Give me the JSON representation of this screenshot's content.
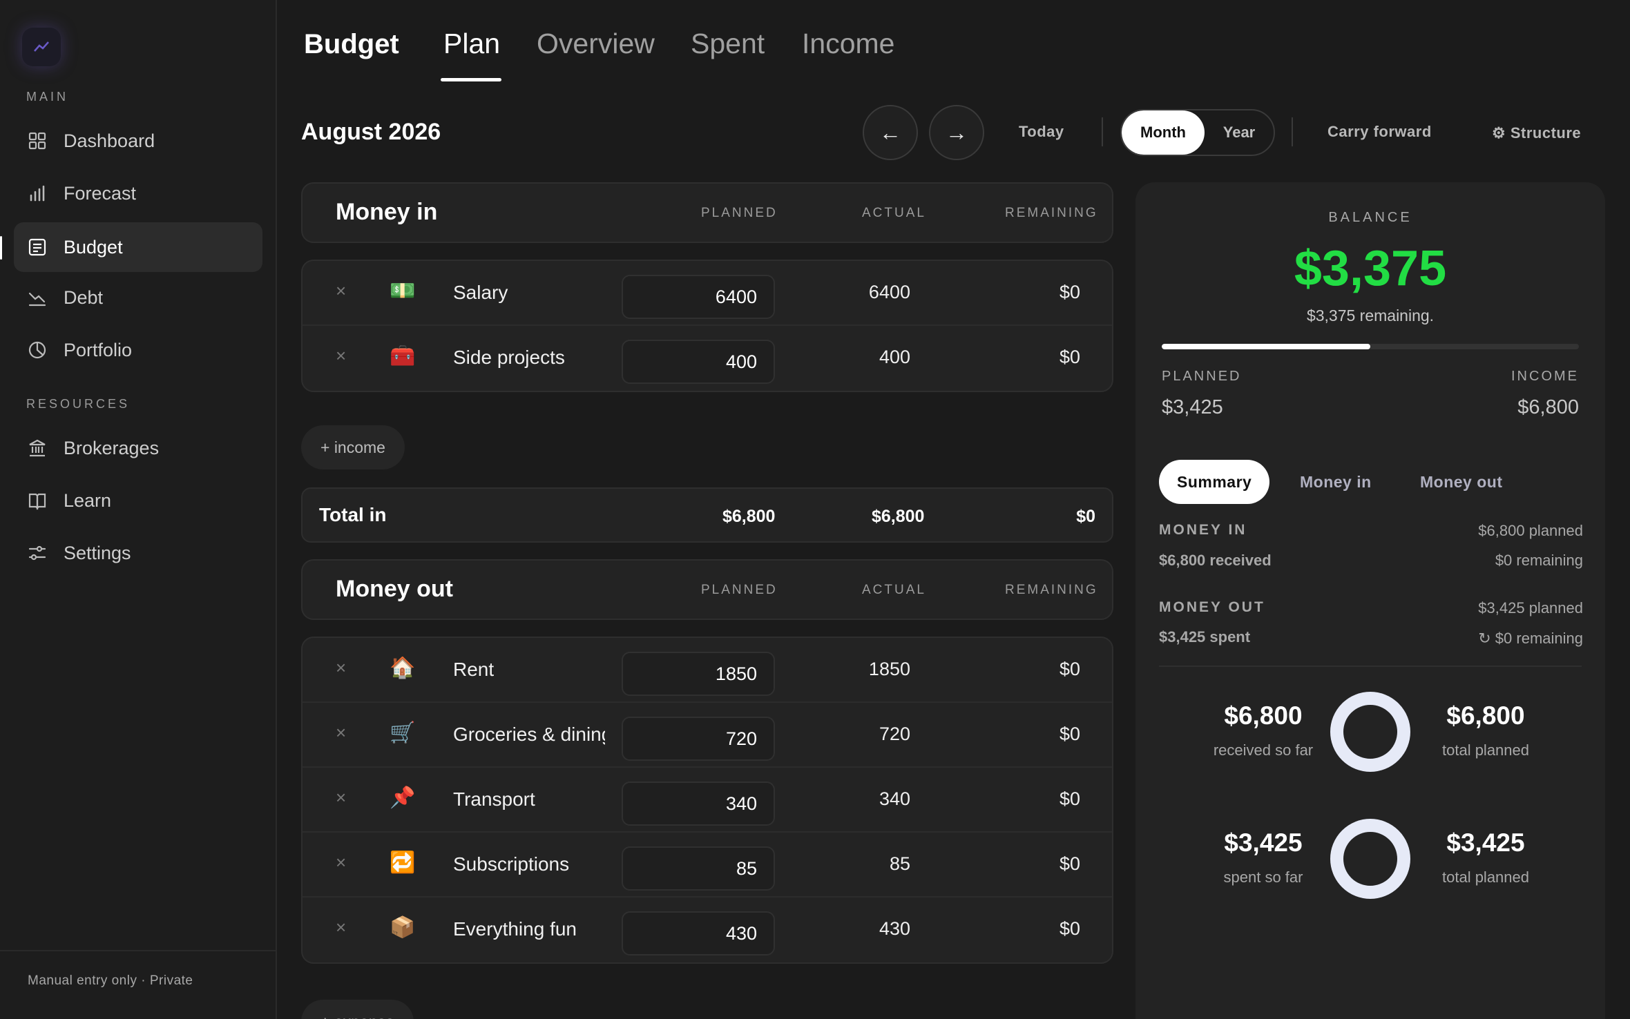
{
  "sidebar": {
    "section_main": "MAIN",
    "section_resources": "RESOURCES",
    "items": [
      {
        "label": "Dashboard",
        "icon": "grid-icon"
      },
      {
        "label": "Forecast",
        "icon": "bar-chart-icon"
      },
      {
        "label": "Budget",
        "icon": "list-icon",
        "active": true
      },
      {
        "label": "Debt",
        "icon": "trend-down-icon"
      },
      {
        "label": "Portfolio",
        "icon": "pie-icon"
      }
    ],
    "resources": [
      {
        "label": "Brokerages",
        "icon": "bank-icon"
      },
      {
        "label": "Learn",
        "icon": "book-icon"
      },
      {
        "label": "Settings",
        "icon": "sliders-icon"
      }
    ],
    "footer": "Manual entry only · Private"
  },
  "header": {
    "title": "Budget",
    "tabs": [
      "Plan",
      "Overview",
      "Spent",
      "Income"
    ],
    "active_tab": "Plan"
  },
  "period": {
    "title": "August 2026",
    "prev": "←",
    "next": "→",
    "today": "Today",
    "month": "Month",
    "year": "Year",
    "carry_forward": "Carry forward",
    "structure": "⚙ Structure"
  },
  "columns": {
    "planned": "PLANNED",
    "actual": "ACTUAL",
    "remaining": "REMAINING"
  },
  "money_in": {
    "title": "Money in",
    "rows": [
      {
        "emoji": "💵",
        "name": "Salary",
        "planned": "6400",
        "actual": "6400",
        "remaining": "$0"
      },
      {
        "emoji": "🧰",
        "name": "Side projects",
        "planned": "400",
        "actual": "400",
        "remaining": "$0"
      }
    ],
    "add_label": "+ income"
  },
  "total_in": {
    "label": "Total in",
    "planned": "$6,800",
    "actual": "$6,800",
    "remaining": "$0"
  },
  "money_out": {
    "title": "Money out",
    "rows": [
      {
        "emoji": "🏠",
        "name": "Rent",
        "planned": "1850",
        "actual": "1850",
        "remaining": "$0"
      },
      {
        "emoji": "🛒",
        "name": "Groceries & dining",
        "planned": "720",
        "actual": "720",
        "remaining": "$0"
      },
      {
        "emoji": "📌",
        "name": "Transport",
        "planned": "340",
        "actual": "340",
        "remaining": "$0"
      },
      {
        "emoji": "🔁",
        "name": "Subscriptions",
        "planned": "85",
        "actual": "85",
        "remaining": "$0"
      },
      {
        "emoji": "📦",
        "name": "Everything fun",
        "planned": "430",
        "actual": "430",
        "remaining": "$0"
      }
    ],
    "add_label": "+ expense"
  },
  "balance": {
    "label": "BALANCE",
    "value": "$3,375",
    "sub": "$3,375 remaining.",
    "progress": 0.5,
    "planned_label": "PLANNED",
    "planned_value": "$3,425",
    "income_label": "INCOME",
    "income_value": "$6,800",
    "value_color": "#22dd44"
  },
  "panel_tabs": [
    "Summary",
    "Money in",
    "Money out"
  ],
  "summary": {
    "in_heading": "MONEY IN",
    "in_planned": "$6,800 planned",
    "in_received": "$6,800 received",
    "in_remaining": "$0 remaining",
    "out_heading": "MONEY OUT",
    "out_planned": "$3,425 planned",
    "out_spent": "$3,425 spent",
    "out_remaining": "↻ $0 remaining"
  },
  "rings": [
    {
      "left_value": "$6,800",
      "left_label": "received so far",
      "right_value": "$6,800",
      "right_label": "total planned"
    },
    {
      "left_value": "$3,425",
      "left_label": "spent so far",
      "right_value": "$3,425",
      "right_label": "total planned"
    }
  ]
}
